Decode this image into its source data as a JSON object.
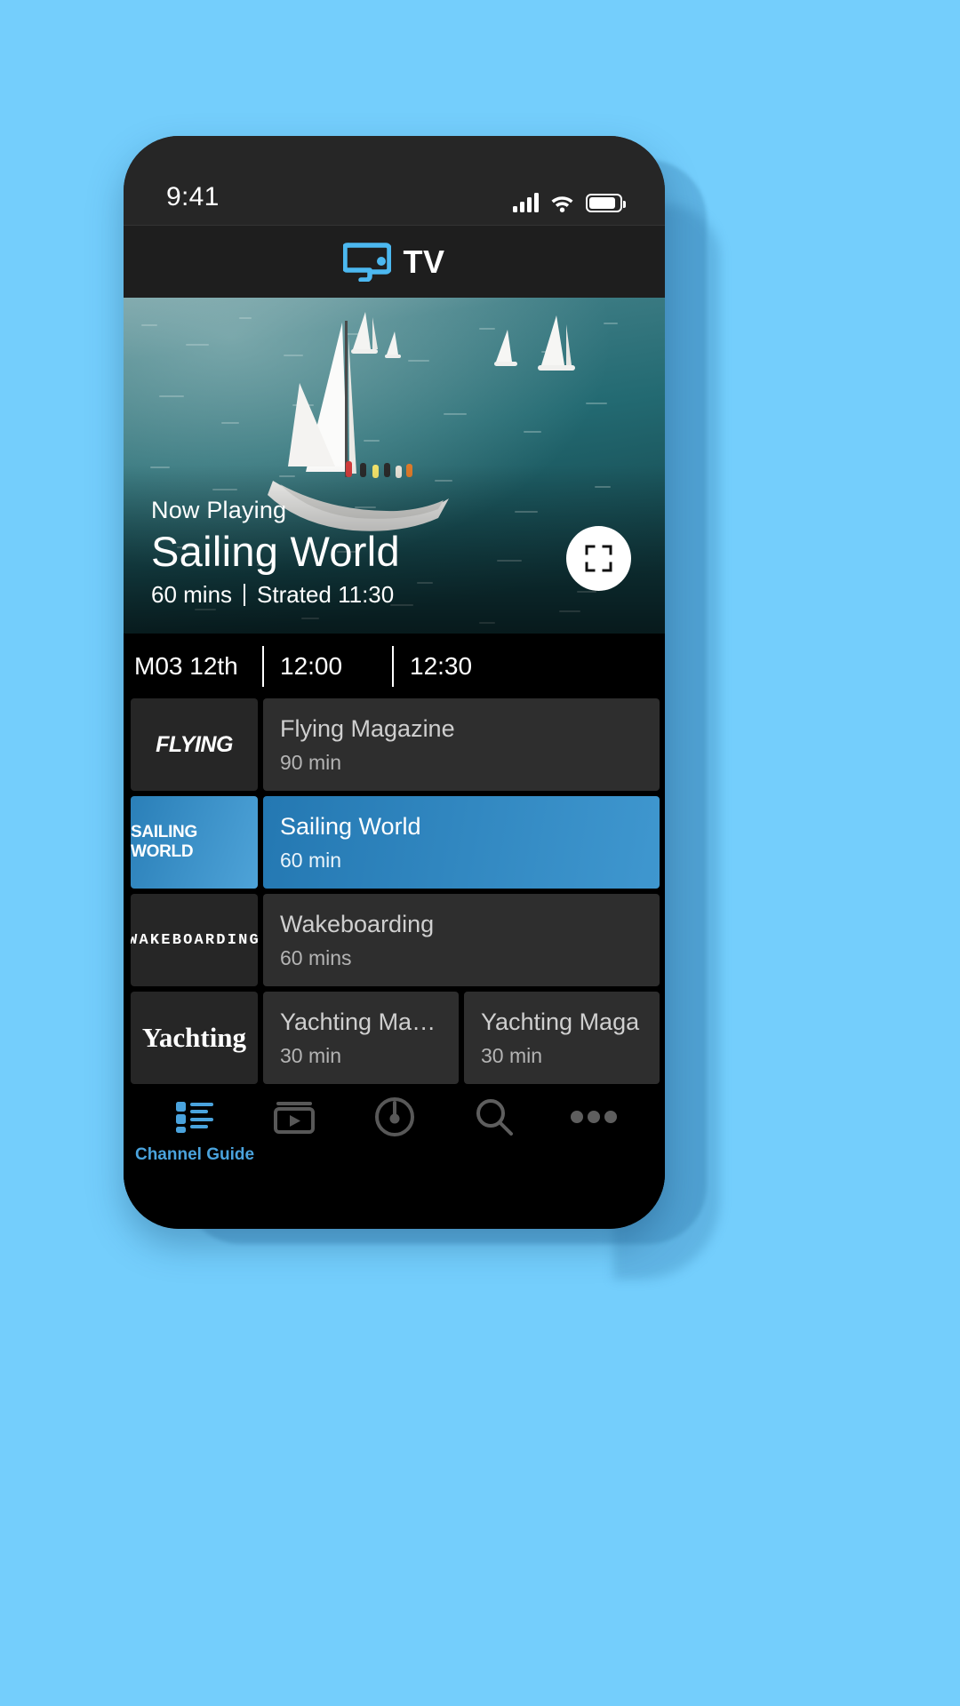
{
  "background_color": "#74cefc",
  "accent_color": "#4aa3dd",
  "status_bar": {
    "time": "9:41",
    "signal_icon": "cellular-signal-icon",
    "wifi_icon": "wifi-icon",
    "battery_icon": "battery-icon"
  },
  "app_bar": {
    "logo_icon": "tv-screen-logo-icon",
    "title": "TV"
  },
  "hero": {
    "label": "Now Playing",
    "title": "Sailing World",
    "duration": "60 mins",
    "separator": "|",
    "started": "Strated 11:30",
    "fullscreen_icon": "fullscreen-expand-icon"
  },
  "guide": {
    "date": "M03 12th",
    "time_slots": [
      "12:00",
      "12:30"
    ],
    "rows": [
      {
        "channel": "FLYING",
        "channel_style": "flying",
        "active": false,
        "programs": [
          {
            "title": "Flying Magazine",
            "duration": "90 min",
            "width": "wide",
            "active": false
          }
        ]
      },
      {
        "channel": "SAILING WORLD",
        "channel_style": "sail",
        "active": true,
        "programs": [
          {
            "title": "Sailing World",
            "duration": "60 min",
            "width": "wide",
            "active": true
          }
        ]
      },
      {
        "channel": "WAKEBOARDING",
        "channel_style": "wake",
        "active": false,
        "programs": [
          {
            "title": "Wakeboarding",
            "duration": "60 mins",
            "width": "wide",
            "active": false
          }
        ]
      },
      {
        "channel": "Yachting",
        "channel_style": "yacht",
        "active": false,
        "programs": [
          {
            "title": "Yachting Maga...",
            "duration": "30 min",
            "width": "half",
            "active": false
          },
          {
            "title": "Yachting Maga",
            "duration": "30 min",
            "width": "half",
            "active": false
          }
        ]
      }
    ]
  },
  "bottom_nav": [
    {
      "icon": "channel-guide-list-icon",
      "label": "Channel Guide",
      "active": true
    },
    {
      "icon": "on-demand-video-icon",
      "label": "",
      "active": false
    },
    {
      "icon": "live-broadcast-icon",
      "label": "",
      "active": false
    },
    {
      "icon": "search-icon",
      "label": "",
      "active": false
    },
    {
      "icon": "more-ellipsis-icon",
      "label": "",
      "active": false
    }
  ]
}
